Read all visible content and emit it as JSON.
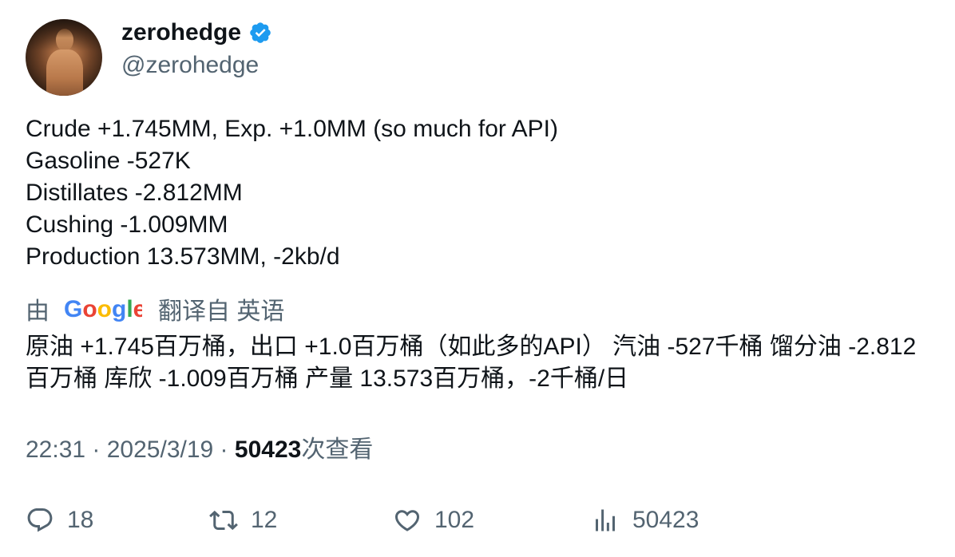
{
  "author": {
    "display_name": "zerohedge",
    "handle": "@zerohedge",
    "verified_icon": "verified-badge-icon",
    "avatar_icon": "avatar"
  },
  "tweet": {
    "lines": [
      "Crude +1.745MM, Exp. +1.0MM (so much for API)",
      "Gasoline -527K",
      "Distillates -2.812MM",
      "Cushing -1.009MM",
      "Production 13.573MM, -2kb/d"
    ]
  },
  "translation": {
    "by": "由",
    "provider": "Google",
    "from": "翻译自 英语",
    "text": "原油 +1.745百万桶，出口 +1.0百万桶（如此多的API） 汽油 -527千桶 馏分油 -2.812百万桶 库欣 -1.009百万桶 产量 13.573百万桶，-2千桶/日"
  },
  "meta": {
    "time": "22:31",
    "separator": " · ",
    "date": "2025/3/19",
    "views_count": "50423",
    "views_label": "次查看"
  },
  "actions": {
    "reply": {
      "icon": "reply-icon",
      "count": "18"
    },
    "retweet": {
      "icon": "retweet-icon",
      "count": "12"
    },
    "like": {
      "icon": "heart-icon",
      "count": "102"
    },
    "views": {
      "icon": "analytics-icon",
      "count": "50423"
    }
  },
  "colors": {
    "text_primary": "#0f1419",
    "text_secondary": "#536471",
    "verified_blue": "#1d9bf0",
    "google_blue": "#4285f4",
    "google_red": "#ea4335",
    "google_yellow": "#fbbc05",
    "google_green": "#34a853"
  }
}
